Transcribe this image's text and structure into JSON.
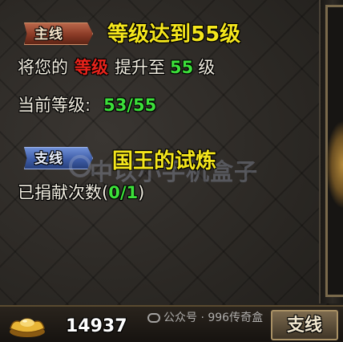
{
  "main_quest": {
    "tag": "主线",
    "title": "等级达到55级",
    "requirement": {
      "prefix": "将您的",
      "highlight": "等级",
      "middle": "提升至",
      "target_level": "55",
      "suffix": "级"
    },
    "current_level_label": "当前等级:",
    "current_level_value": "53/55"
  },
  "side_quest": {
    "tag": "支线",
    "title": "国王的试炼",
    "donate_label": "已捐献次数(",
    "donate_value": "0/1",
    "donate_close": ")"
  },
  "watermark": "中以小手机盒子",
  "bottom_bar": {
    "gold_amount": "14937",
    "account_watermark": "公众号 · 996传奇盒",
    "side_button_label": "支线"
  },
  "colors": {
    "quest_title": "#f4e61c",
    "highlight_red": "#e8231b",
    "value_green": "#3ce03a",
    "main_tag": "#8a3a26",
    "side_tag": "#3e5da8"
  },
  "icons": [
    "gold-ingot-icon",
    "wechat-icon"
  ]
}
